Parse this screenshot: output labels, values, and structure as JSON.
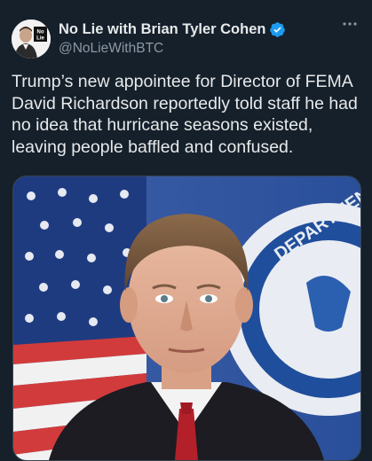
{
  "tweet": {
    "author": {
      "display_name": "No Lie with Brian Tyler Cohen",
      "handle": "@NoLieWithBTC",
      "avatar_badge_lines": [
        "No",
        "Lie"
      ],
      "verified": true
    },
    "text": "Trump’s new appointee for Director of FEMA David Richardson reportedly told staff he had no idea that hurricane seasons existed, leaving people baffled and confused.",
    "media": {
      "description_icon": "photo-of-man-in-suit-before-flags",
      "seal_text": "DEPARTMEN"
    }
  },
  "colors": {
    "background": "#15202b",
    "text": "#e7e9ea",
    "secondary": "#8b98a5",
    "verified": "#1d9bf0"
  }
}
